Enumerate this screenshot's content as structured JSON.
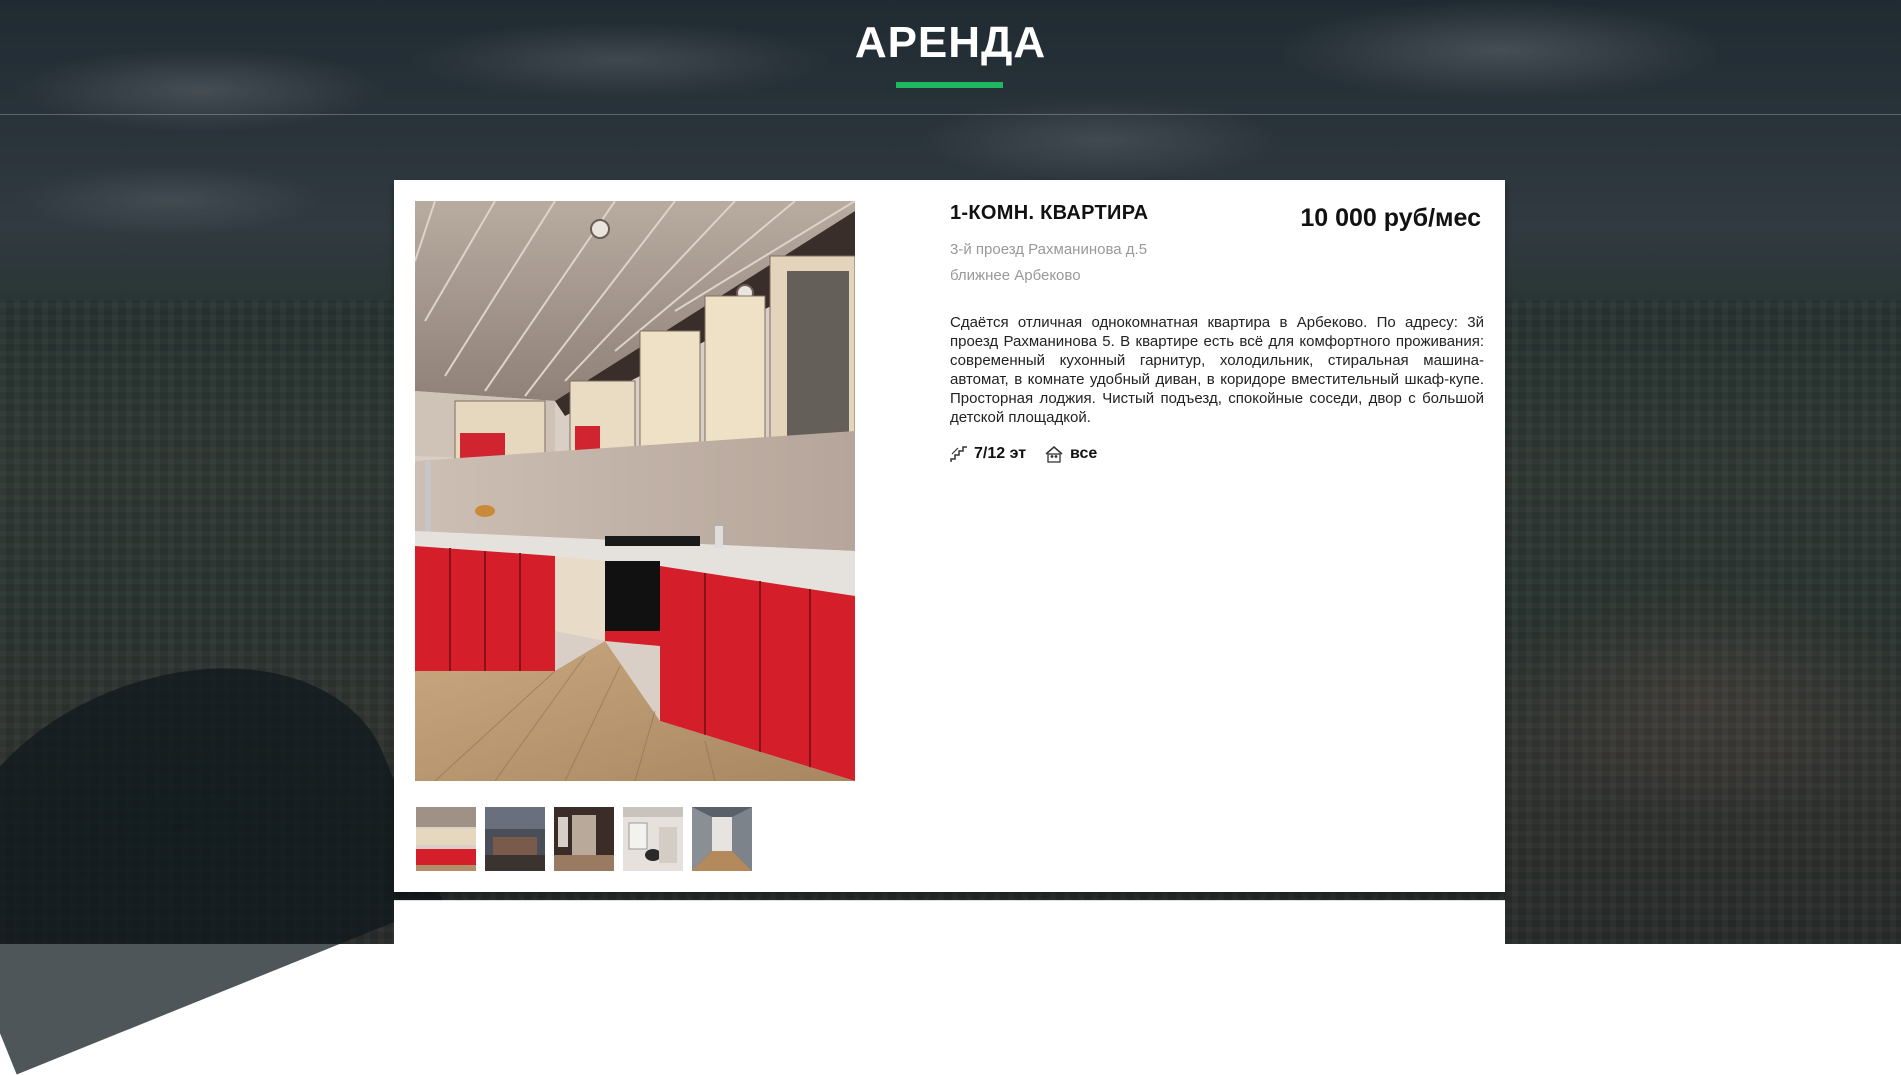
{
  "header": {
    "title": "АРЕНДА"
  },
  "listing": {
    "type": "1-КОМН. КВАРТИРА",
    "price": "10 000 руб/мес",
    "address_line1": "3-й проезд Рахманинова д.5",
    "address_line2": "ближнее Арбеково",
    "description": "Сдаётся отличная однокомнатная квартира в Арбеково. По адресу: 3й проезд Рахманинова 5. В квартире есть всё для комфортного проживания: современный кухонный гарнитур, холодильник, стиральная машина-автомат, в комнате удобный диван, в коридоре вместительный шкаф-купе. Просторная лоджия. Чистый подъезд, спокойные соседи, двор с большой детской площадкой.",
    "floor": "7/12 эт",
    "floor_icon": "stairs-icon",
    "tenants": "все",
    "tenants_icon": "people-house-icon"
  },
  "colors": {
    "accent": "#1fb760",
    "kitchen_red": "#d81f2a"
  }
}
